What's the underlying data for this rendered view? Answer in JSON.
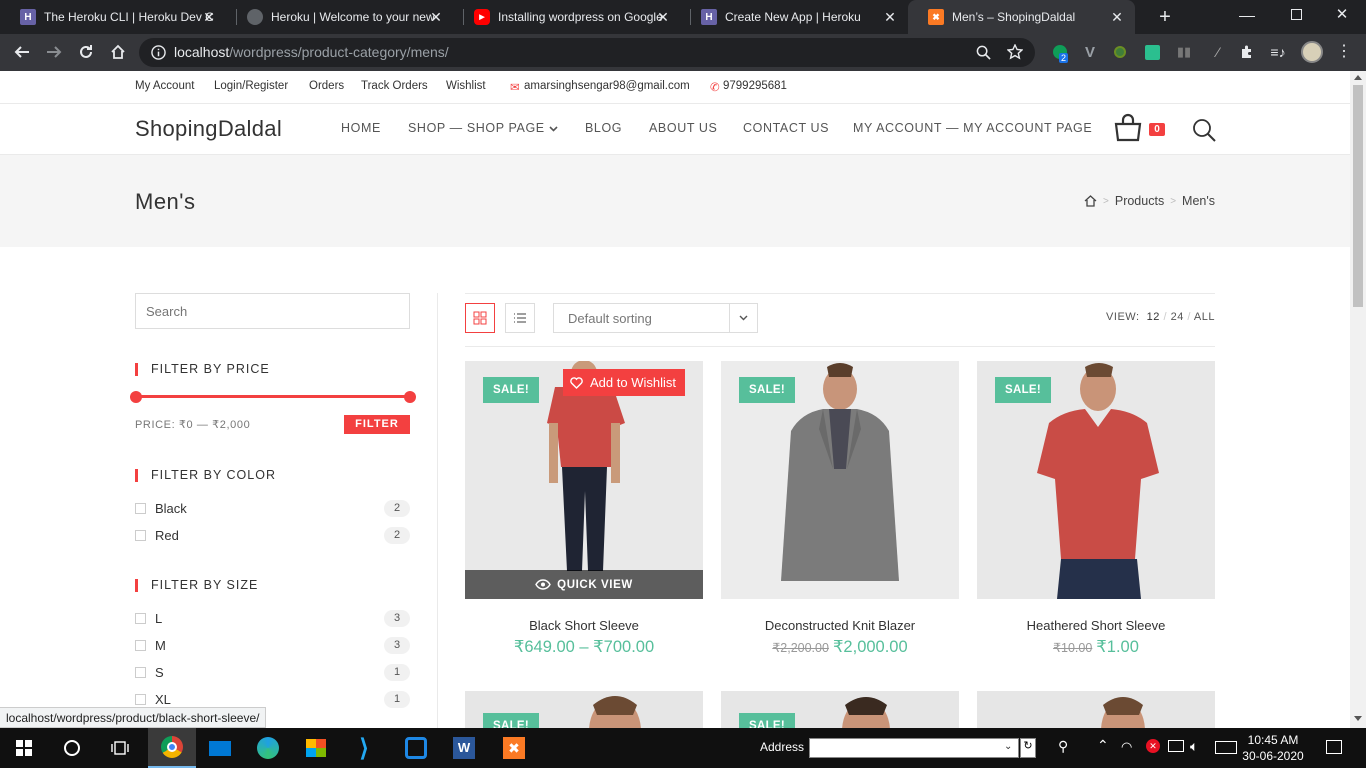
{
  "browser": {
    "tabs": [
      {
        "title": "The Heroku CLI | Heroku Dev C",
        "favicon": "heroku-icon",
        "color": "#6762a6",
        "letter": "H"
      },
      {
        "title": "Heroku | Welcome to your new",
        "favicon": "globe-icon",
        "color": "#5f6368",
        "letter": ""
      },
      {
        "title": "Installing wordpress on Google",
        "favicon": "youtube-icon",
        "color": "#ff0000",
        "letter": "▶"
      },
      {
        "title": "Create New App | Heroku",
        "favicon": "heroku-icon",
        "color": "#6762a6",
        "letter": "H"
      },
      {
        "title": "Men’s – ShopingDaldal",
        "favicon": "xampp-icon",
        "color": "#fb7a24",
        "letter": "✖"
      }
    ],
    "url_host": "localhost",
    "url_path": "/wordpress/product-category/mens/",
    "extension_badge": "2"
  },
  "topbar": {
    "links": [
      "My Account",
      "Login/Register",
      "Orders",
      "Track Orders",
      "Wishlist"
    ],
    "email": "amarsinghsengar98@gmail.com",
    "phone": "9799295681"
  },
  "header": {
    "logo": "ShopingDaldal",
    "nav": [
      "HOME",
      "SHOP — SHOP PAGE",
      "BLOG",
      "ABOUT US",
      "CONTACT US",
      "MY ACCOUNT — MY ACCOUNT PAGE"
    ],
    "cart_count": "0"
  },
  "page_header": {
    "title": "Men's",
    "breadcrumbs": [
      "Products",
      "Men's"
    ]
  },
  "sidebar": {
    "search_placeholder": "Search",
    "price_title": "FILTER BY PRICE",
    "price_label": "PRICE: ₹0 — ₹2,000",
    "filter_button": "FILTER",
    "price_min": 0,
    "price_max": 2000,
    "color_title": "FILTER BY COLOR",
    "colors": [
      {
        "label": "Black",
        "count": "2"
      },
      {
        "label": "Red",
        "count": "2"
      }
    ],
    "size_title": "FILTER BY SIZE",
    "sizes": [
      {
        "label": "L",
        "count": "3"
      },
      {
        "label": "M",
        "count": "3"
      },
      {
        "label": "S",
        "count": "1"
      },
      {
        "label": "XL",
        "count": "1"
      }
    ]
  },
  "shop_toolbar": {
    "sorting": "Default sorting",
    "view_label": "VIEW:",
    "view_options": [
      "12",
      "24",
      "ALL"
    ]
  },
  "products": [
    {
      "name": "Black Short Sleeve",
      "price": "₹649.00 – ₹700.00",
      "old_price": "",
      "badge": "SALE!",
      "wishlist": "Add to Wishlist",
      "quick_view": "QUICK VIEW"
    },
    {
      "name": "Deconstructed Knit Blazer",
      "price": "₹2,000.00",
      "old_price": "₹2,200.00",
      "badge": "SALE!"
    },
    {
      "name": "Heathered Short Sleeve",
      "price": "₹1.00",
      "old_price": "₹10.00",
      "badge": "SALE!"
    }
  ],
  "more_products_badges": [
    "SALE!",
    "SALE!"
  ],
  "status_url": "localhost/wordpress/product/black-short-sleeve/",
  "taskbar": {
    "address_label": "Address",
    "time": "10:45 AM",
    "date": "30-06-2020"
  },
  "colors": {
    "accent": "#f34040",
    "sale": "#57bf9b"
  }
}
